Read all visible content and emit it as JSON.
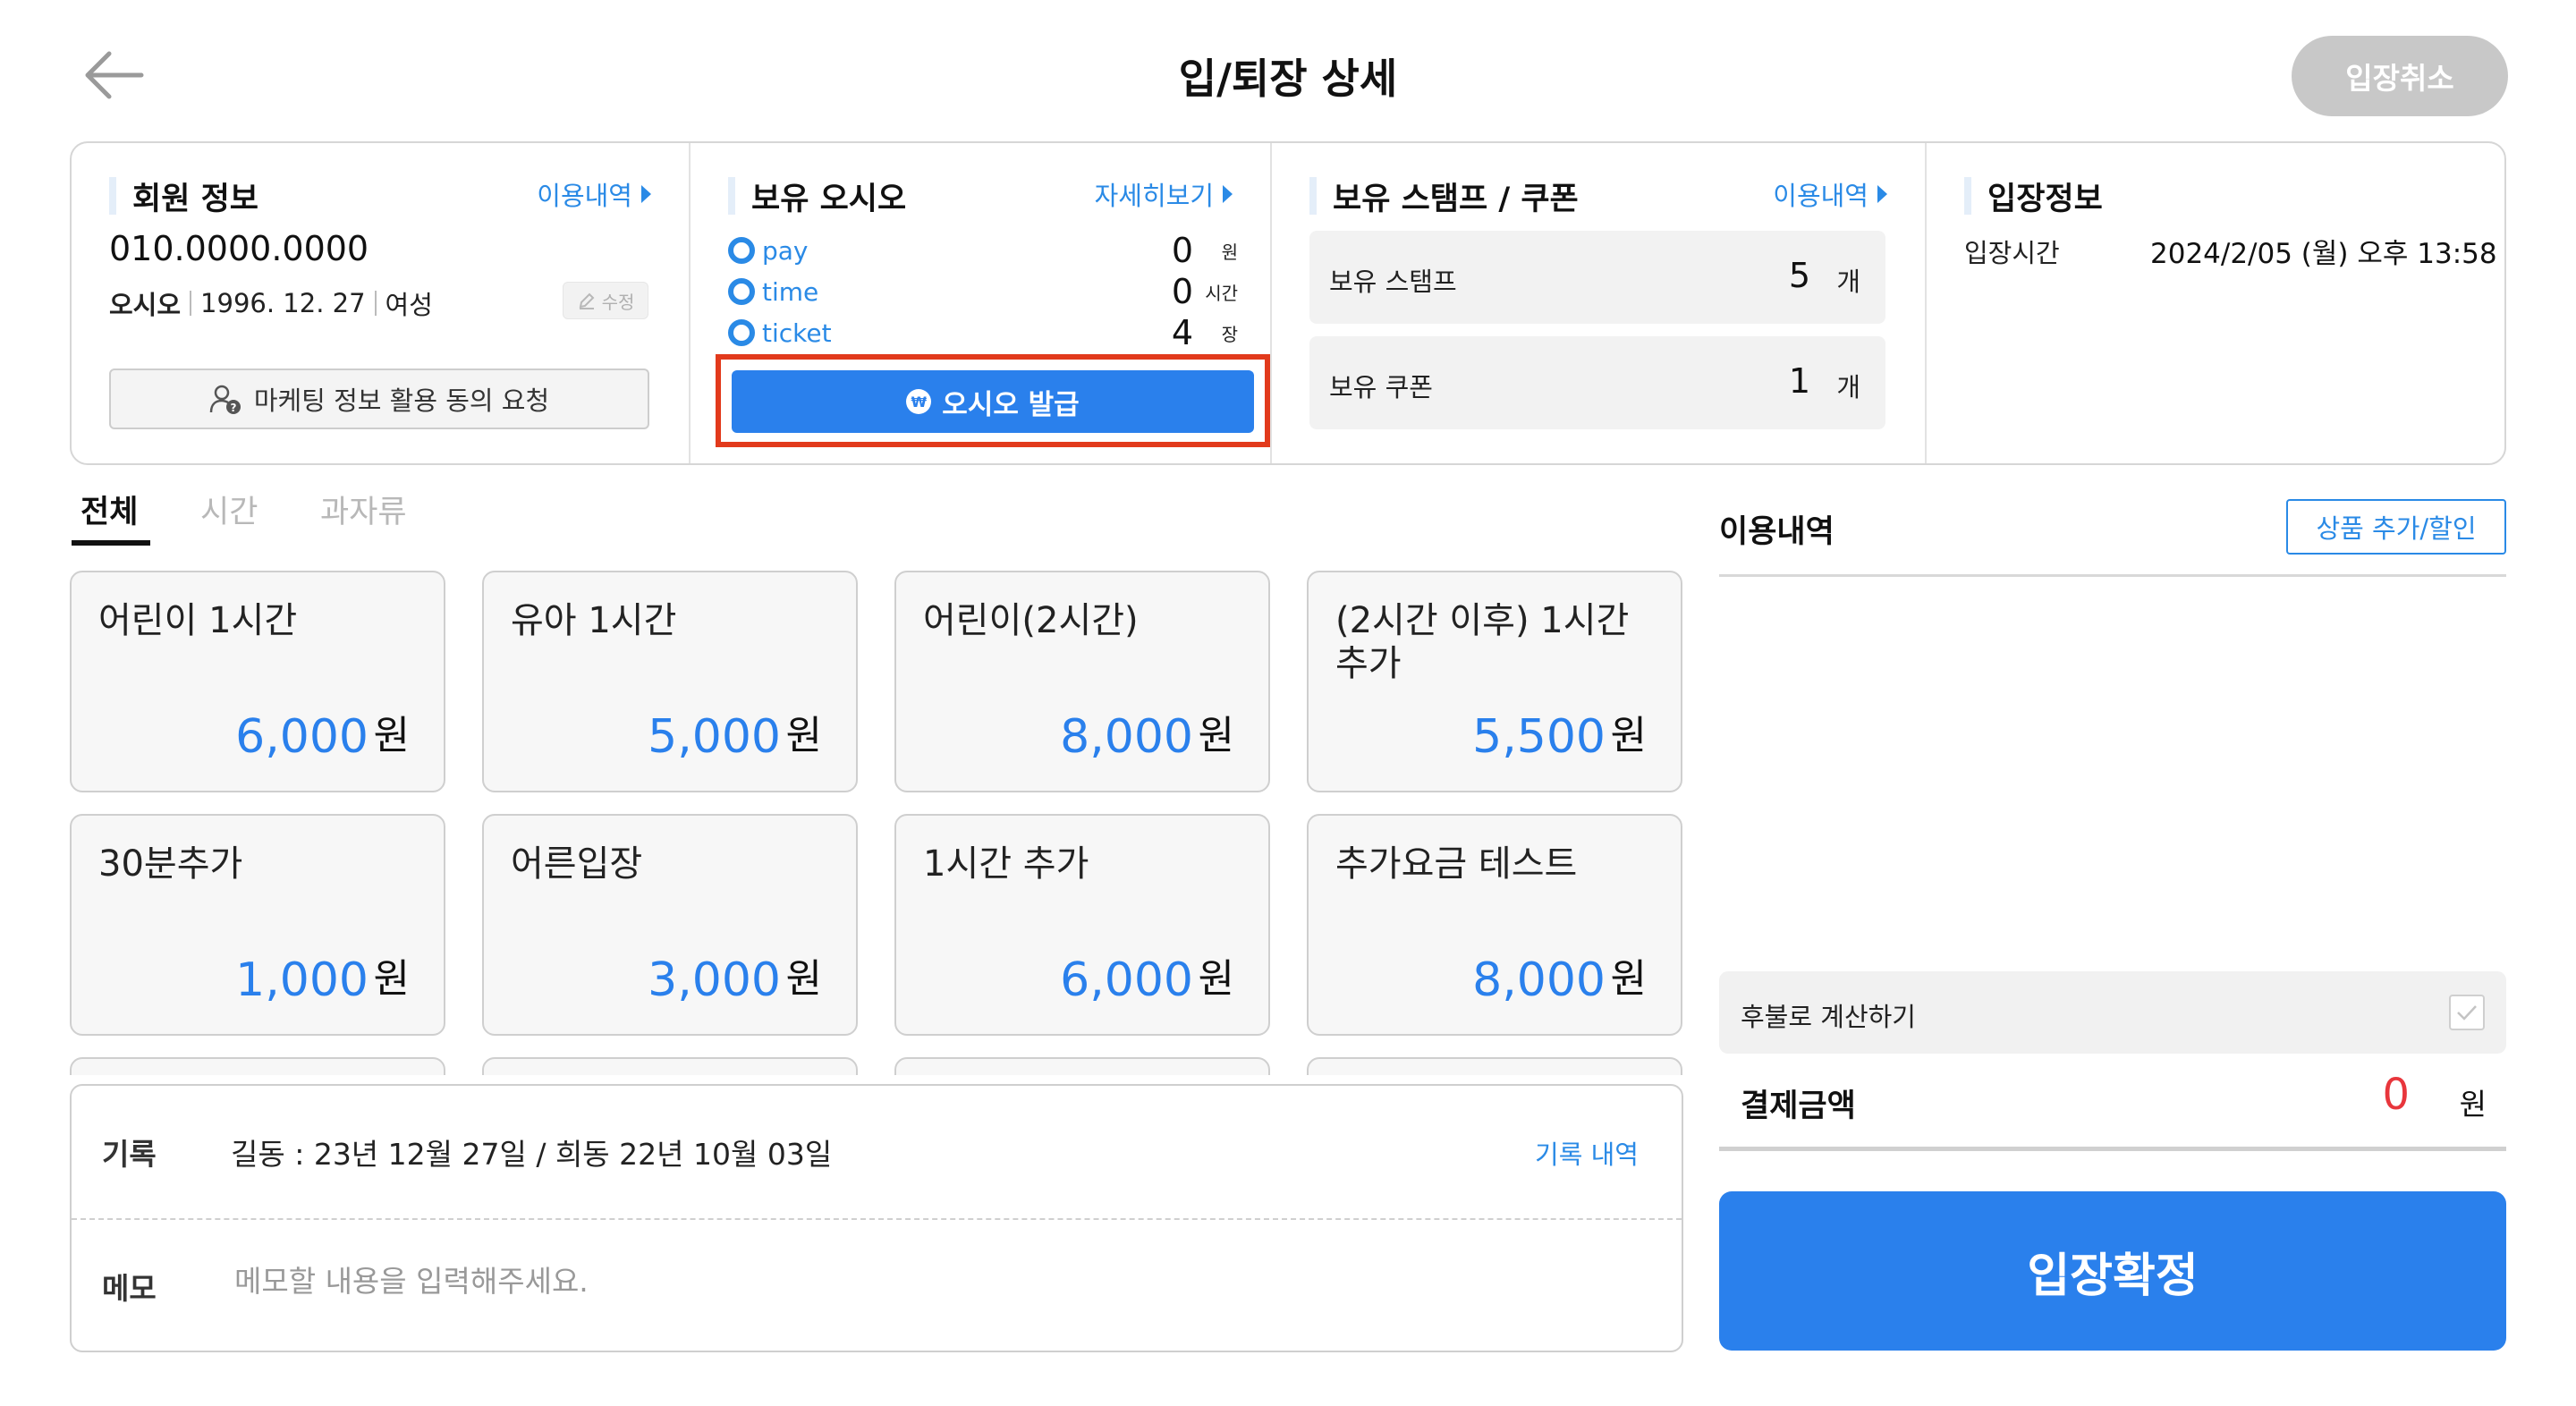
{
  "header": {
    "title": "입/퇴장 상세",
    "cancel_label": "입장취소"
  },
  "member": {
    "section_title": "회원 정보",
    "history_link": "이용내역",
    "phone": "010.0000.0000",
    "name": "오시오",
    "birth": "1996. 12. 27",
    "gender": "여성",
    "edit_label": "수정",
    "marketing_label": "마케팅 정보 활용 동의 요청"
  },
  "points": {
    "section_title": "보유 오시오",
    "detail_link": "자세히보기",
    "items": [
      {
        "name": "pay",
        "value": "0",
        "unit": "원"
      },
      {
        "name": "time",
        "value": "0",
        "unit": "시간"
      },
      {
        "name": "ticket",
        "value": "4",
        "unit": "장"
      }
    ],
    "issue_label": "오시오 발급",
    "coin_symbol": "₩"
  },
  "stamps": {
    "section_title": "보유 스탬프 / 쿠폰",
    "history_link": "이용내역",
    "stamp_label": "보유 스탬프",
    "stamp_count": "5",
    "coupon_label": "보유 쿠폰",
    "coupon_count": "1",
    "unit": "개"
  },
  "entry": {
    "section_title": "입장정보",
    "time_label": "입장시간",
    "time_value": "2024/2/05 (월) 오후 13:58"
  },
  "tabs": [
    {
      "label": "전체",
      "active": true
    },
    {
      "label": "시간",
      "active": false
    },
    {
      "label": "과자류",
      "active": false
    }
  ],
  "products": [
    {
      "name": "어린이 1시간",
      "price": "6,000",
      "unit": "원"
    },
    {
      "name": "유아 1시간",
      "price": "5,000",
      "unit": "원"
    },
    {
      "name": "어린이(2시간)",
      "price": "8,000",
      "unit": "원"
    },
    {
      "name": "(2시간 이후) 1시간 추가",
      "price": "5,500",
      "unit": "원"
    },
    {
      "name": "30분추가",
      "price": "1,000",
      "unit": "원"
    },
    {
      "name": "어른입장",
      "price": "3,000",
      "unit": "원"
    },
    {
      "name": "1시간 추가",
      "price": "6,000",
      "unit": "원"
    },
    {
      "name": "추가요금 테스트",
      "price": "8,000",
      "unit": "원"
    }
  ],
  "record": {
    "label": "기록",
    "text": "길동 : 23년 12월 27일 / 희동 22년 10월 03일",
    "history_link": "기록 내역",
    "memo_label": "메모",
    "memo_placeholder": "메모할 내용을 입력해주세요."
  },
  "usage": {
    "title": "이용내역",
    "add_button": "상품 추가/할인",
    "postpay_label": "후불로 계산하기",
    "pay_label": "결제금액",
    "pay_amount": "0",
    "pay_unit": "원",
    "confirm_label": "입장확정"
  },
  "colors": {
    "accent": "#2a80ec",
    "link": "#2a8ae6",
    "highlight": "#e23a1c",
    "amount": "#e8363c"
  }
}
